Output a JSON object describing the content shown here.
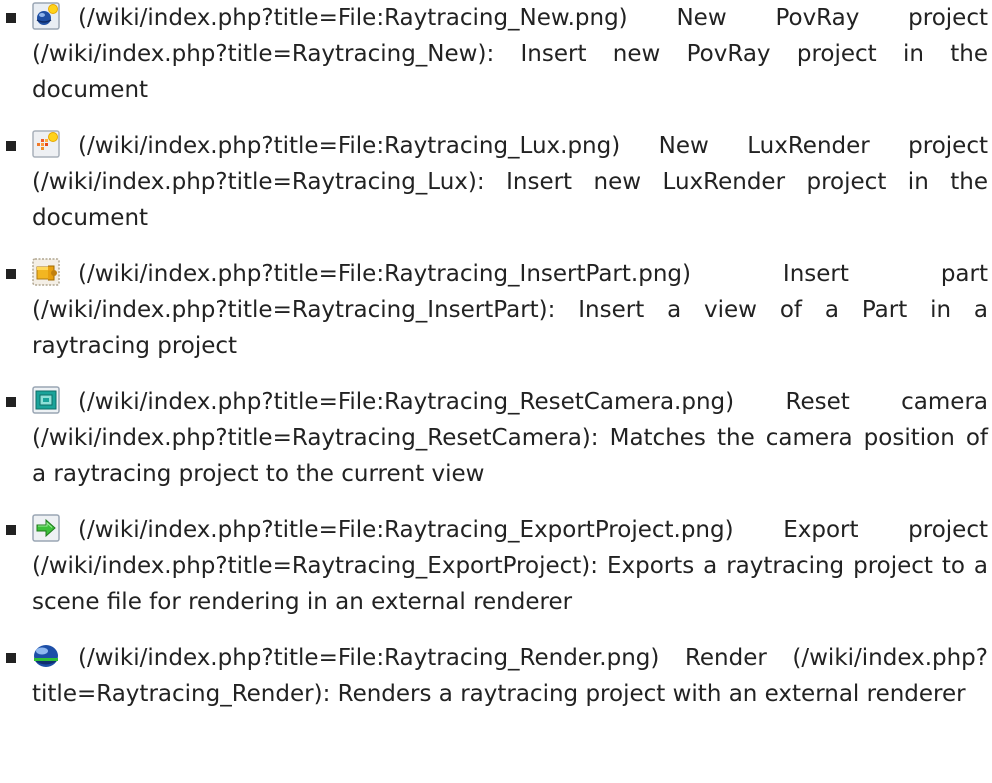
{
  "items": [
    {
      "icon": "raytracing-new-povray-icon",
      "file_link": "(/wiki/index.php?title=File:Raytracing_New.png)",
      "name": "New PovRay project",
      "page_link": "(/wiki/index.php?title=Raytracing_New)",
      "description": ": Insert new PovRay project in the document"
    },
    {
      "icon": "raytracing-new-luxrender-icon",
      "file_link": "(/wiki/index.php?title=File:Raytracing_Lux.png)",
      "name": "New LuxRender project",
      "page_link": "(/wiki/index.php?title=Raytracing_Lux)",
      "description": ": Insert new LuxRender project in the document"
    },
    {
      "icon": "raytracing-insert-part-icon",
      "file_link": "(/wiki/index.php?title=File:Raytracing_InsertPart.png)",
      "name": "Insert part",
      "page_link": "(/wiki/index.php?title=Raytracing_InsertPart)",
      "description": ": Insert a view of a Part in a raytracing project"
    },
    {
      "icon": "raytracing-reset-camera-icon",
      "file_link": "(/wiki/index.php?title=File:Raytracing_ResetCamera.png)",
      "name": "Reset camera",
      "page_link": "(/wiki/index.php?title=Raytracing_ResetCamera)",
      "description": ": Matches the camera position of a raytracing project to the current view"
    },
    {
      "icon": "raytracing-export-project-icon",
      "file_link": "(/wiki/index.php?title=File:Raytracing_ExportProject.png)",
      "name": "Export project",
      "page_link": "(/wiki/index.php?title=Raytracing_ExportProject)",
      "description": ": Exports a raytracing project to a scene file for rendering in an external renderer"
    },
    {
      "icon": "raytracing-render-icon",
      "file_link": "(/wiki/index.php?title=File:Raytracing_Render.png)",
      "name": "Render",
      "page_link": "(/wiki/index.php?title=Raytracing_Render)",
      "description": ": Renders a raytracing project with an external renderer"
    }
  ]
}
